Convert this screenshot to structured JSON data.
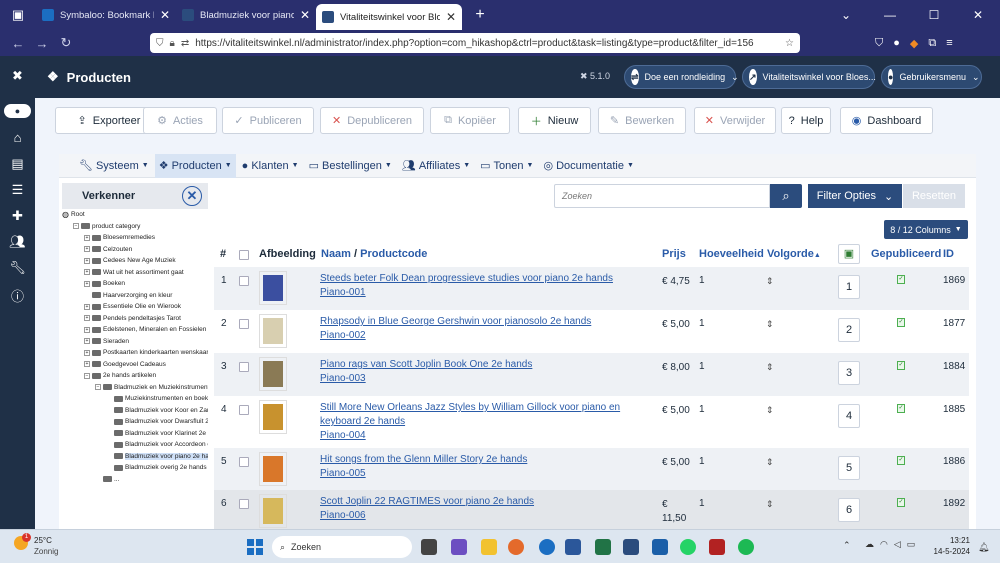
{
  "browser": {
    "tabs": [
      {
        "label": "Symbaloo: Bookmark Manager",
        "color": "#1b6ec2"
      },
      {
        "label": "Bladmuziek voor piano 2e hands",
        "color": "#2b4c7d"
      },
      {
        "label": "Vitaliteitswinkel voor Bloesem",
        "color": "#2b4c7d",
        "active": true
      }
    ],
    "url": "https://vitaliteitswinkel.nl/administrator/index.php?option=com_hikashop&ctrl=product&task=listing&type=product&filter_id=156"
  },
  "header": {
    "title": "Producten",
    "version": "5.1.0",
    "tour": "Doe een rondleiding",
    "site": "Vitaliteitswinkel voor Bloes...",
    "user": "Gebruikersmenu"
  },
  "toolbar": {
    "export": "Exporteer",
    "actions": "Acties",
    "publish": "Publiceren",
    "unpublish": "Depubliceren",
    "copy": "Kopiëer",
    "new": "Nieuw",
    "edit": "Bewerken",
    "delete": "Verwijder",
    "help": "Help",
    "dashboard": "Dashboard"
  },
  "menu": [
    "Systeem",
    "Producten",
    "Klanten",
    "Bestellingen",
    "Affiliates",
    "Tonen",
    "Documentatie"
  ],
  "explorer": {
    "title": "Verkenner",
    "nodes": [
      {
        "label": "Root",
        "indent": 0,
        "type": "root"
      },
      {
        "label": "product category",
        "indent": 1,
        "type": "open"
      },
      {
        "label": "Bloesemremedies",
        "indent": 2,
        "type": "closed"
      },
      {
        "label": "Celzouten",
        "indent": 2,
        "type": "closed"
      },
      {
        "label": "Cedees New Age Muziek",
        "indent": 2,
        "type": "closed"
      },
      {
        "label": "Wat uit het assortiment gaat",
        "indent": 2,
        "type": "closed"
      },
      {
        "label": "Boeken",
        "indent": 2,
        "type": "closed"
      },
      {
        "label": "Haarverzorging en kleur",
        "indent": 2,
        "type": "leaf"
      },
      {
        "label": "Essentiele Olie en Wierook",
        "indent": 2,
        "type": "closed"
      },
      {
        "label": "Pendels pendeltasjes Tarot",
        "indent": 2,
        "type": "closed"
      },
      {
        "label": "Edelstenen, Mineralen en Fossielen",
        "indent": 2,
        "type": "closed"
      },
      {
        "label": "Sieraden",
        "indent": 2,
        "type": "closed"
      },
      {
        "label": "Postkaarten kinderkaarten wenskaarten",
        "indent": 2,
        "type": "closed"
      },
      {
        "label": "Goedgevoel Cadeaus",
        "indent": 2,
        "type": "closed"
      },
      {
        "label": "2e hands artikelen",
        "indent": 2,
        "type": "open"
      },
      {
        "label": "Bladmuziek en Muziekinstrumenten",
        "indent": 3,
        "type": "open"
      },
      {
        "label": "Muziekinstrumenten en boeken",
        "indent": 4,
        "type": "leaf"
      },
      {
        "label": "Bladmuziek voor Koor en Zang",
        "indent": 4,
        "type": "leaf"
      },
      {
        "label": "Bladmuziek voor Dwarsfluit 2e",
        "indent": 4,
        "type": "leaf"
      },
      {
        "label": "Bladmuziek voor Klarinet 2e h",
        "indent": 4,
        "type": "leaf"
      },
      {
        "label": "Bladmuziek voor Accordeon e",
        "indent": 4,
        "type": "leaf"
      },
      {
        "label": "Bladmuziek voor piano 2e han",
        "indent": 4,
        "type": "leaf",
        "selected": true
      },
      {
        "label": "Bladmuziek overig 2e hands",
        "indent": 4,
        "type": "leaf"
      },
      {
        "label": "...",
        "indent": 3,
        "type": "leaf"
      }
    ]
  },
  "search": {
    "placeholder": "Zoeken",
    "filter": "Filter Opties",
    "reset": "Resetten",
    "columns": "8 / 12  Columns"
  },
  "table": {
    "headers": {
      "num": "#",
      "image": "Afbeelding",
      "name": "Naam",
      "code": "Productcode",
      "price": "Prijs",
      "qty": "Hoeveelheid",
      "order": "Volgorde",
      "published": "Gepubliceerd",
      "id": "ID"
    },
    "rows": [
      {
        "n": "1",
        "name": "Steeds beter Folk Dean progressieve studies voor piano 2e hands",
        "code": "Piano-001",
        "price": "€ 4,75",
        "qty": "1",
        "order": "1",
        "id": "1869",
        "img": "#3b4fa0"
      },
      {
        "n": "2",
        "name": "Rhapsody in Blue George Gershwin voor pianosolo 2e hands",
        "code": "Piano-002",
        "price": "€ 5,00",
        "qty": "1",
        "order": "2",
        "id": "1877",
        "img": "#d8cfb0"
      },
      {
        "n": "3",
        "name": "Piano rags van Scott Joplin Book One 2e hands",
        "code": "Piano-003",
        "price": "€ 8,00",
        "qty": "1",
        "order": "3",
        "id": "1884",
        "img": "#8a7a55"
      },
      {
        "n": "4",
        "name": "Still More New Orleans Jazz Styles by William Gillock voor piano en keyboard 2e hands",
        "code": "Piano-004",
        "price": "€ 5,00",
        "qty": "1",
        "order": "4",
        "id": "1885",
        "img": "#c8922e"
      },
      {
        "n": "5",
        "name": "Hit songs from the Glenn Miller Story 2e hands",
        "code": "Piano-005",
        "price": "€ 5,00",
        "qty": "1",
        "order": "5",
        "id": "1886",
        "img": "#d9772a"
      },
      {
        "n": "6",
        "name": "Scott Joplin 22 RAGTIMES voor piano 2e hands",
        "code": "Piano-006",
        "price": "€",
        "price2": "11,50",
        "qty": "1",
        "order": "6",
        "id": "1892",
        "img": "#d6b85c"
      }
    ]
  },
  "taskbar": {
    "weather_temp": "25°C",
    "weather_desc": "Zonnig",
    "search": "Zoeken",
    "time": "13:21",
    "date": "14-5-2024",
    "badge": "1"
  }
}
